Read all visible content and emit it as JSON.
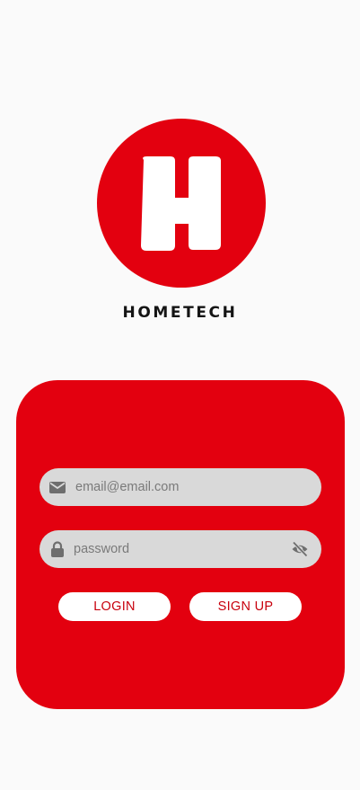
{
  "brand": {
    "logo_letter": "H",
    "name": "HOMETECH",
    "color": "#e3000f"
  },
  "login_form": {
    "email": {
      "placeholder": "email@email.com",
      "value": "",
      "icon": "envelope-icon"
    },
    "password": {
      "placeholder": "password",
      "value": "",
      "icon": "lock-icon",
      "toggle_icon": "eye-slash-icon"
    },
    "login_label": "LOGIN",
    "signup_label": "SIGN UP"
  }
}
